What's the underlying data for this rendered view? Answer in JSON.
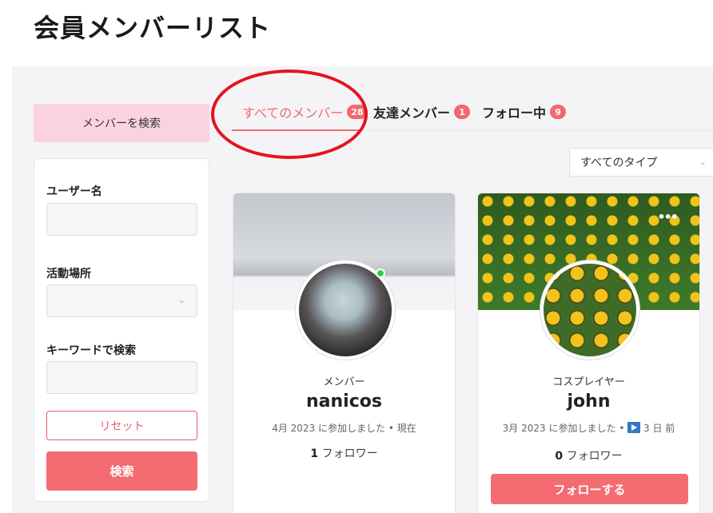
{
  "page": {
    "title": "会員メンバーリスト"
  },
  "sidebar": {
    "header": "メンバーを検索",
    "username_label": "ユーザー名",
    "username_value": "",
    "location_label": "活動場所",
    "location_value": "",
    "keyword_label": "キーワードで検索",
    "keyword_value": "",
    "reset_label": "リセット",
    "search_label": "検索"
  },
  "tabs": [
    {
      "label": "すべてのメンバー",
      "count": "28",
      "active": true
    },
    {
      "label": "友達メンバー",
      "count": "1",
      "active": false
    },
    {
      "label": "フォロー中",
      "count": "9",
      "active": false
    }
  ],
  "filter": {
    "selected": "すべてのタイプ"
  },
  "members": [
    {
      "role": "メンバー",
      "name": "nanicos",
      "joined": "4月 2023 に参加しました",
      "separator": "•",
      "last_active": "現在",
      "followers_count": "1",
      "followers_label": "フォロワー",
      "online": true
    },
    {
      "role": "コスプレイヤー",
      "name": "john",
      "joined": "3月 2023 に参加しました",
      "separator": "•",
      "last_active": "3 日 前",
      "followers_count": "0",
      "followers_label": "フォロワー",
      "follow_button": "フォローする",
      "more_icon": "more-dots-icon"
    }
  ],
  "colors": {
    "accent": "#f46c72",
    "search_header_bg": "#fbd3de",
    "annotation_circle": "#e5141e",
    "online": "#2bd44a"
  }
}
